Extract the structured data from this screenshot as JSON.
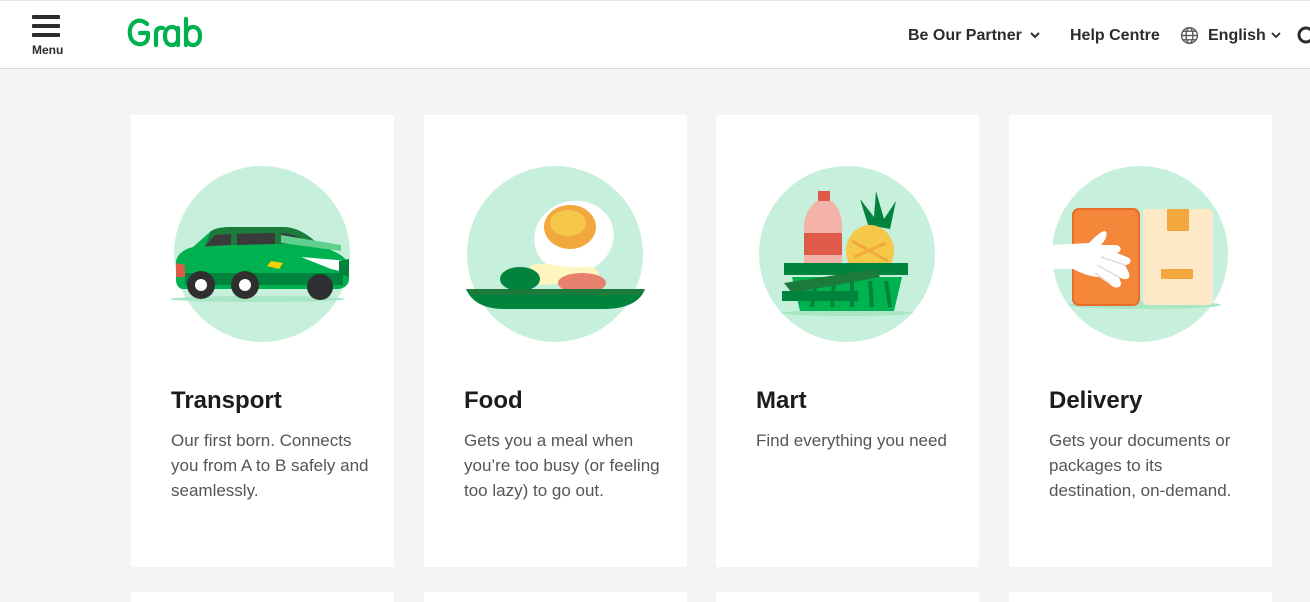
{
  "header": {
    "menu_label": "Menu",
    "logo_text": "Grab",
    "nav": {
      "partner": "Be Our Partner",
      "help": "Help Centre",
      "language": "English"
    }
  },
  "cards": [
    {
      "title": "Transport",
      "desc": "Our first born. Connects you from A to B safely and seamlessly.",
      "icon": "car-illustration"
    },
    {
      "title": "Food",
      "desc": "Gets you a meal when you’re too busy (or feeling too lazy) to go out.",
      "icon": "food-illustration"
    },
    {
      "title": "Mart",
      "desc": "Find everything you need",
      "icon": "grocery-basket-illustration"
    },
    {
      "title": "Delivery",
      "desc": "Gets your documents or packages to its destination, on-demand.",
      "icon": "package-delivery-illustration"
    }
  ],
  "colors": {
    "brand_green": "#00b14f",
    "dark_green": "#00843d",
    "mint_circle": "#c6f0db",
    "page_bg": "#f4f4f4"
  }
}
